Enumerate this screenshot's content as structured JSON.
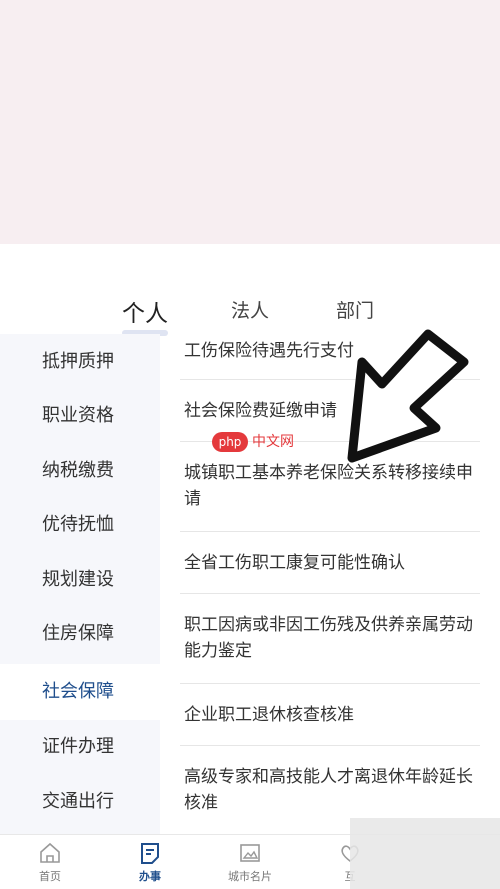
{
  "tabs": [
    {
      "label": "个人"
    },
    {
      "label": "法人"
    },
    {
      "label": "部门"
    }
  ],
  "sidebar": {
    "items": [
      {
        "label": "抵押质押"
      },
      {
        "label": "职业资格"
      },
      {
        "label": "纳税缴费"
      },
      {
        "label": "优待抚恤"
      },
      {
        "label": "规划建设"
      },
      {
        "label": "住房保障"
      },
      {
        "label": "社会保障"
      },
      {
        "label": "证件办理"
      },
      {
        "label": "交通出行"
      }
    ],
    "active": "社会保障"
  },
  "list": {
    "items": [
      {
        "label": "工伤保险待遇先行支付"
      },
      {
        "label": "社会保险费延缴申请"
      },
      {
        "label": "城镇职工基本养老保险关系转移接续申请"
      },
      {
        "label": "全省工伤职工康复可能性确认"
      },
      {
        "label": "职工因病或非因工伤残及供养亲属劳动能力鉴定"
      },
      {
        "label": "企业职工退休核查核准"
      },
      {
        "label": "高级专家和高技能人才离退休年龄延长核准"
      }
    ]
  },
  "watermark": {
    "badge": "php",
    "text": "中文网"
  },
  "bottom_nav": {
    "items": [
      {
        "label": "首页",
        "icon": "home-icon"
      },
      {
        "label": "办事",
        "icon": "document-icon"
      },
      {
        "label": "城市名片",
        "icon": "image-icon"
      },
      {
        "label": "互",
        "icon": "heart-icon"
      }
    ],
    "active": "办事"
  },
  "colors": {
    "accent": "#1f4e8c",
    "banner": "#f7eef1",
    "sidebar_bg": "#f6f7fb"
  }
}
